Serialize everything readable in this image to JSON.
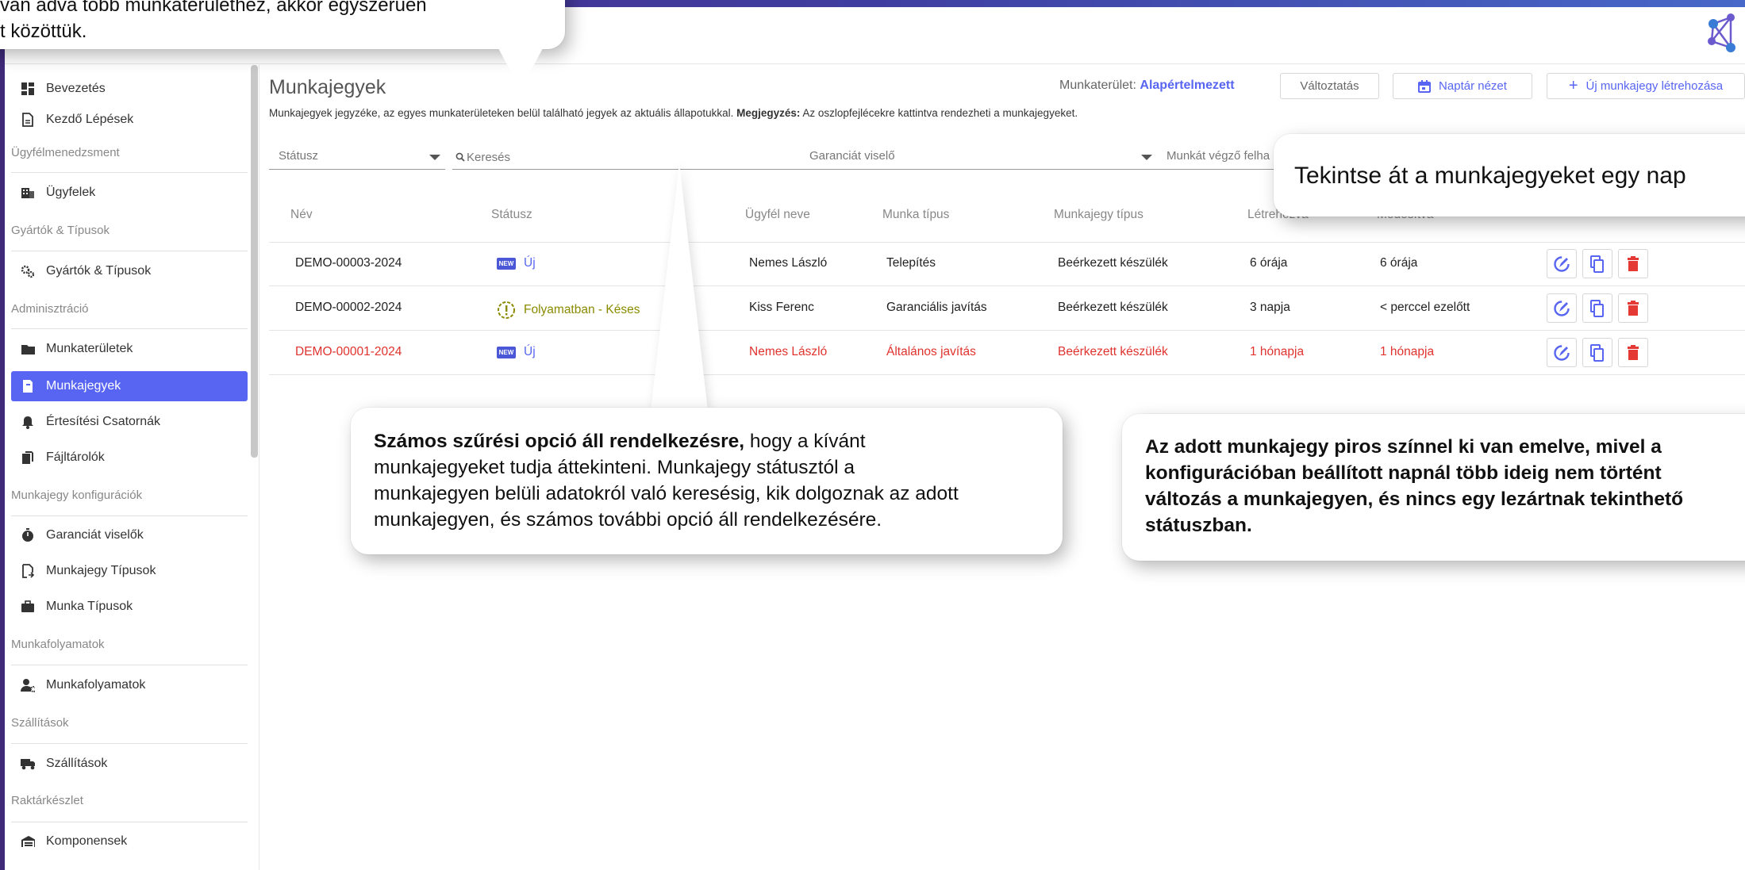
{
  "top_callout": {
    "line1": "van adva több munkaterülethez, akkor egyszerűen",
    "line2": "t közöttük."
  },
  "sidebar": {
    "items": [
      {
        "label": "Bevezetés",
        "icon": "dashboard-icon"
      },
      {
        "label": "Kezdő Lépések",
        "icon": "document-icon"
      },
      {
        "label": "Ügyfelek",
        "icon": "building-icon"
      },
      {
        "label": "Gyártók & Típusok",
        "icon": "gears-icon"
      },
      {
        "label": "Munkaterületek",
        "icon": "folder-icon"
      },
      {
        "label": "Munkajegyek",
        "icon": "ticket-icon"
      },
      {
        "label": "Értesítési Csatornák",
        "icon": "bell-icon"
      },
      {
        "label": "Fájltárolók",
        "icon": "files-icon"
      },
      {
        "label": "Garanciát viselők",
        "icon": "stopwatch-icon"
      },
      {
        "label": "Munkajegy Típusok",
        "icon": "doc-arrow-icon"
      },
      {
        "label": "Munka Típusok",
        "icon": "briefcase-icon"
      },
      {
        "label": "Munkafolyamatok",
        "icon": "user-gear-icon"
      },
      {
        "label": "Szállítások",
        "icon": "truck-icon"
      },
      {
        "label": "Komponensek",
        "icon": "warehouse-icon"
      }
    ],
    "sections": [
      "Ügyfélmenedzsment",
      "Gyártók & Típusok",
      "Adminisztráció",
      "Munkajegy konfigurációk",
      "Munkafolyamatok",
      "Szállítások",
      "Raktárkészlet"
    ]
  },
  "page": {
    "title": "Munkajegyek",
    "desc_prefix": "Munkajegyek jegyzéke, az egyes munkaterületeken belül található jegyek az aktuális állapotukkal. ",
    "desc_note_label": "Megjegyzés:",
    "desc_suffix": " Az oszlopfejlécekre kattintva rendezheti a munkajegyeket."
  },
  "workspace": {
    "label": "Munkaterület: ",
    "value": "Alapértelmezett",
    "change_button": "Változtatás",
    "calendar_button": "Naptár nézet",
    "new_button": "Új munkajegy létrehozása",
    "new_button_plus": "+"
  },
  "filters": {
    "status": "Státusz",
    "search": "Keresés",
    "warranty": "Garanciát viselő",
    "worker": "Munkát végző felha"
  },
  "table": {
    "headers": [
      "Név",
      "Státusz",
      "Ügyfél neve",
      "Munka típus",
      "Munkajegy típus",
      "Létrehozva",
      "Módosítva"
    ],
    "rows": [
      {
        "name": "DEMO-00003-2024",
        "status": "Új",
        "badge": "NEW",
        "client": "Nemes László",
        "work_type": "Telepítés",
        "ticket_type": "Beérkezett készülék",
        "created": "6 órája",
        "modified": "6 órája"
      },
      {
        "name": "DEMO-00002-2024",
        "status": "Folyamatban - Késes",
        "client": "Kiss Ferenc",
        "work_type": "Garanciális javítás",
        "ticket_type": "Beérkezett készülék",
        "created": "3 napja",
        "modified": "< perccel ezelőtt"
      },
      {
        "name": "DEMO-00001-2024",
        "status": "Új",
        "badge": "NEW",
        "client": "Nemes László",
        "work_type": "Általános javítás",
        "ticket_type": "Beérkezett készülék",
        "created": "1 hónapja",
        "modified": "1 hónapja"
      }
    ]
  },
  "callouts": {
    "calendar": "Tekintse át a munkajegyeket egy nap",
    "filters_bold": "Számos szűrési opció áll rendelkezésre,",
    "filters_line1_rest": " hogy a kívánt",
    "filters_line2": "munkajegyeket tudja áttekinteni. Munkajegy státusztól a",
    "filters_line3": "munkajegyen belüli adatokról való keresésig, kik dolgoznak az adott",
    "filters_line4": "munkajegyen, és számos további opció áll rendelkezésére.",
    "red_line1": "Az adott munkajegy piros színnel ki van emelve, mivel a",
    "red_line2": "konfigurációban beállított napnál több ideig nem történt",
    "red_line3": "változás a munkajegyen, és nincs egy lezártnak tekinthető",
    "red_line4": "státuszban."
  },
  "colors": {
    "accent": "#5865f2",
    "late_row": "#e0322e",
    "late_status": "#8a8a00",
    "delete": "#e53935"
  }
}
